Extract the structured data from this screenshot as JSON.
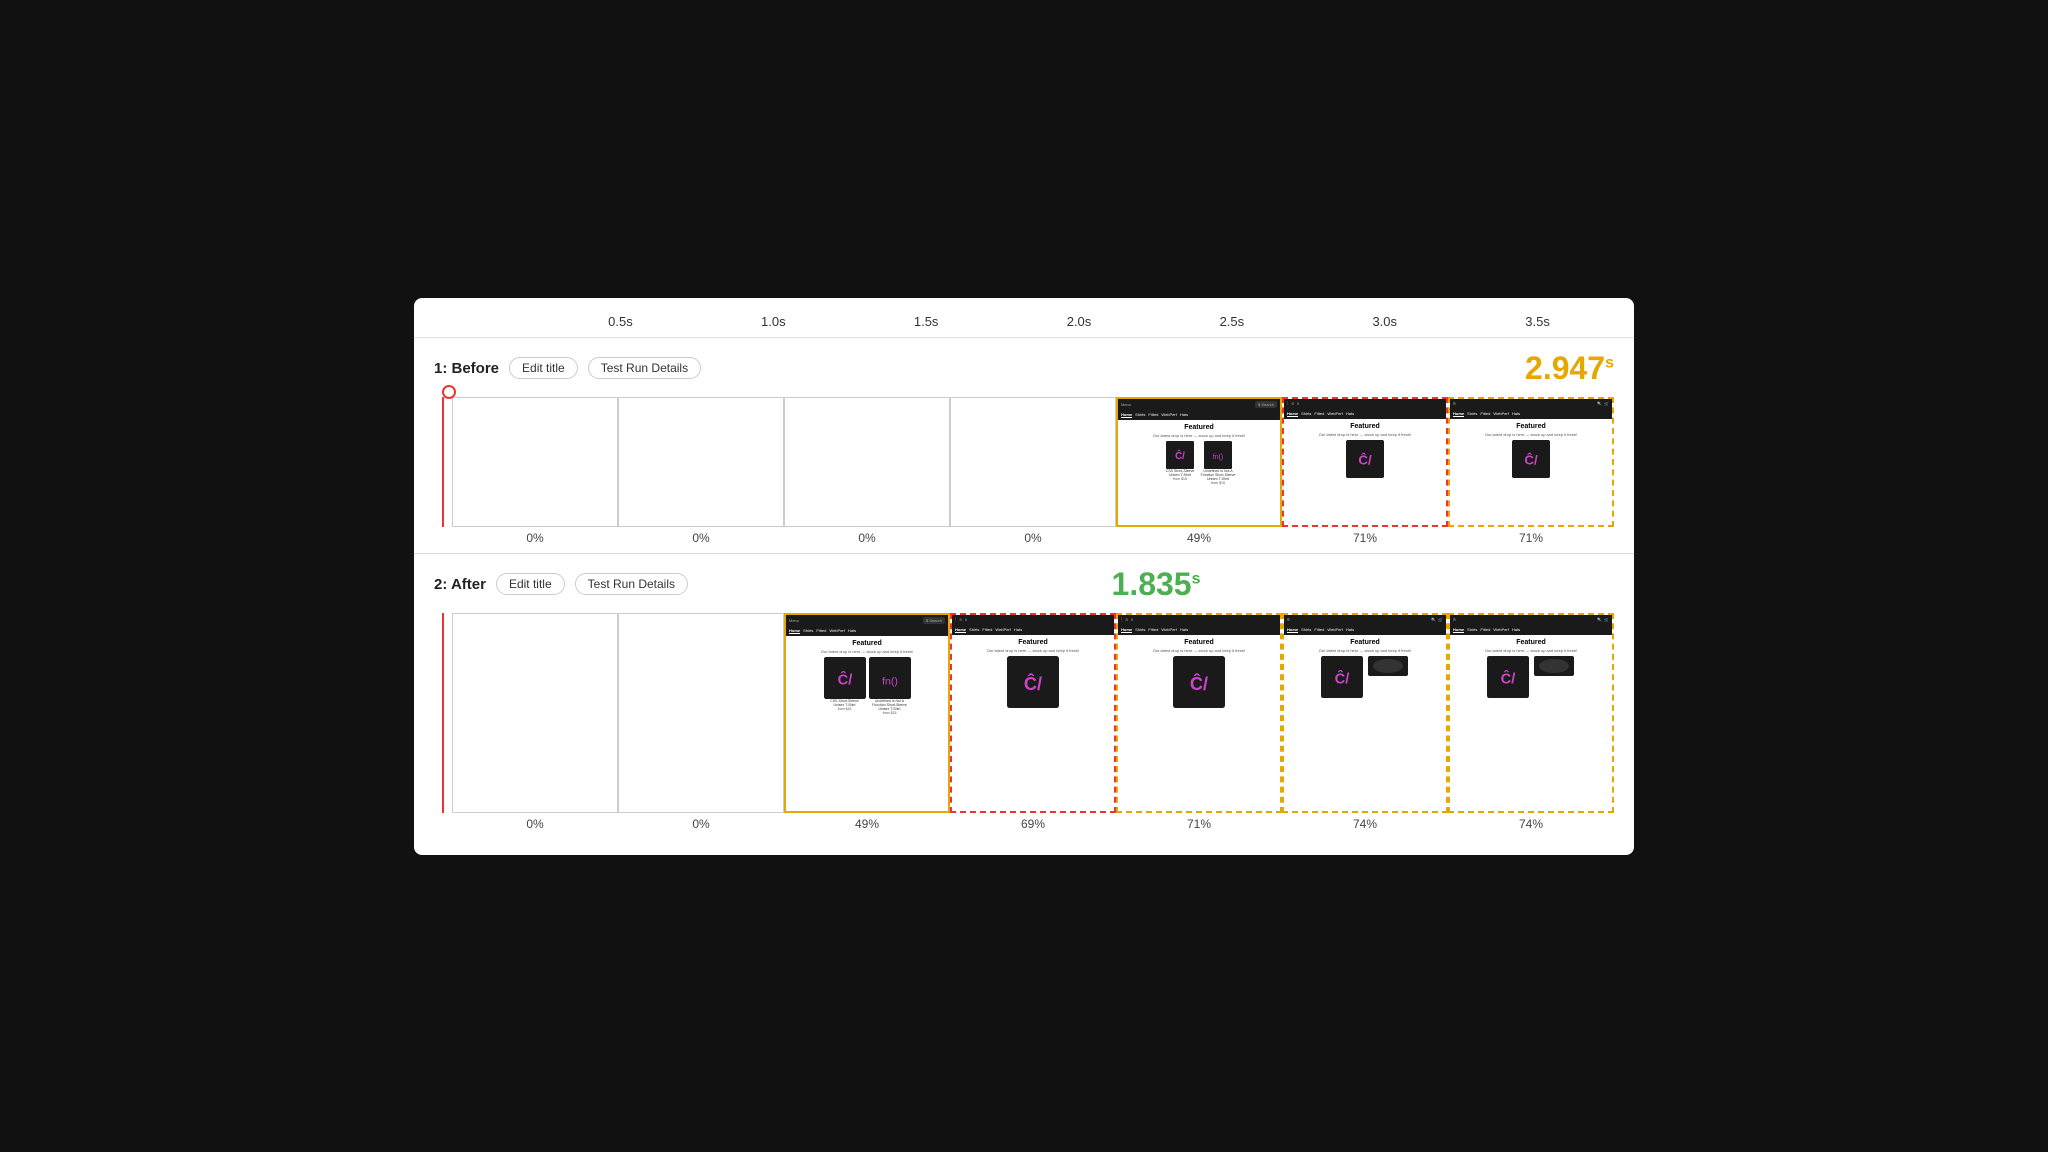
{
  "timeline": {
    "marks": [
      "0.5s",
      "1.0s",
      "1.5s",
      "2.0s",
      "2.5s",
      "3.0s",
      "3.5s"
    ]
  },
  "before": {
    "label": "1: Before",
    "edit_title": "Edit title",
    "test_run": "Test Run Details",
    "time_number": "2.947",
    "time_unit": "s",
    "frames": [
      {
        "label": "0%",
        "type": "blank"
      },
      {
        "label": "0%",
        "type": "blank"
      },
      {
        "label": "0%",
        "type": "blank"
      },
      {
        "label": "0%",
        "type": "blank"
      },
      {
        "label": "49%",
        "type": "browser",
        "border": "yellow-solid"
      },
      {
        "label": "71%",
        "type": "browser",
        "border": "red-dashed"
      },
      {
        "label": "71%",
        "type": "browser",
        "border": "yellow-dashed"
      }
    ]
  },
  "after": {
    "label": "2: After",
    "edit_title": "Edit title",
    "test_run": "Test Run Details",
    "time_number": "1.835",
    "time_unit": "s",
    "frames": [
      {
        "label": "0%",
        "type": "blank"
      },
      {
        "label": "0%",
        "type": "blank"
      },
      {
        "label": "49%",
        "type": "browser",
        "border": "yellow-solid"
      },
      {
        "label": "69%",
        "type": "browser",
        "border": "red-dashed"
      },
      {
        "label": "71%",
        "type": "browser",
        "border": "yellow-dashed"
      },
      {
        "label": "74%",
        "type": "browser",
        "border": "yellow-dashed"
      },
      {
        "label": "74%",
        "type": "browser",
        "border": "yellow-dashed"
      }
    ]
  },
  "nav_links": [
    "Home",
    "Shirts",
    "Fitted",
    "WebPerf",
    "Hats"
  ],
  "featured_text": "Featured",
  "featured_desc": "Our latest drop is here — stock up and keep it fresh!",
  "products": [
    {
      "name": "CSS Short-Sleeve Unisex T-Shirt",
      "price": "from $15"
    },
    {
      "name": "Undefined Is Not A Function Short-Sleeve Unisex T-Shirt",
      "price": "from $15"
    }
  ]
}
